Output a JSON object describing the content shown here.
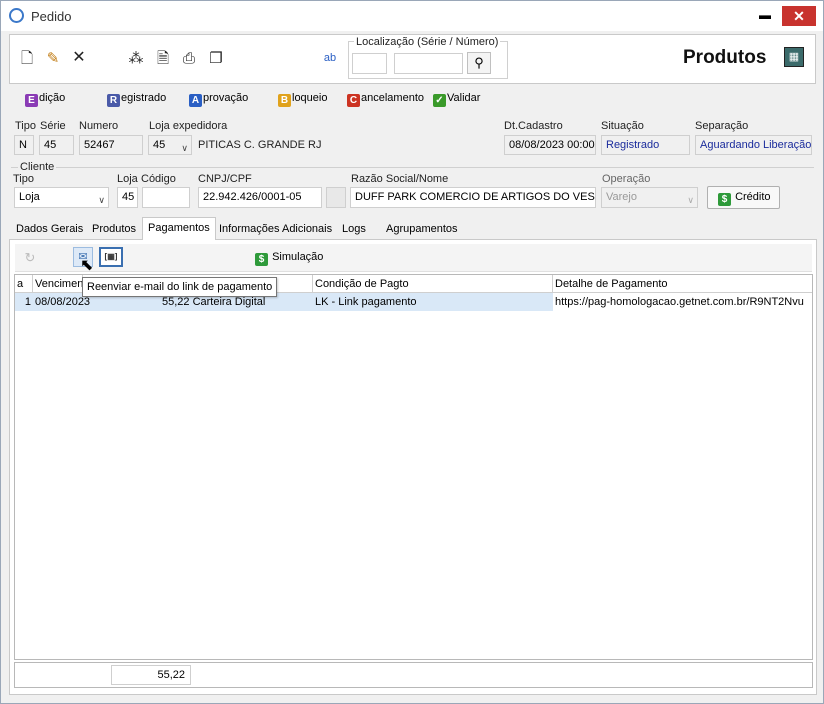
{
  "window": {
    "title": "Pedido",
    "minimize_glyph": "▬",
    "close_glyph": "✕"
  },
  "toolbar": {
    "icons": [
      "new-document-icon",
      "edit-document-icon",
      "delete-icon",
      "wand-icon",
      "preview-icon",
      "print-icon",
      "copy-icon",
      "spell-icon"
    ],
    "localizacao_label": "Localização (Série / Número)",
    "serie_value": "",
    "numero_value": "",
    "section_title": "Produtos"
  },
  "actions": [
    {
      "letter": "E",
      "color": "#8a3bb5",
      "rest": "dição"
    },
    {
      "letter": "R",
      "color": "#4a5aa8",
      "rest": "egistrado"
    },
    {
      "letter": "A",
      "color": "#2a5fc4",
      "rest": "provação"
    },
    {
      "letter": "B",
      "color": "#e0a21c",
      "rest": "loqueio"
    },
    {
      "letter": "C",
      "color": "#cc3322",
      "rest": "ancelamento"
    },
    {
      "letter": "",
      "color": "#3a9a2a",
      "rest": "Validar"
    }
  ],
  "header": {
    "tipo_label": "Tipo",
    "serie_label": "Série",
    "numero_label": "Numero",
    "loja_exp_label": "Loja expedidora",
    "dtcadastro_label": "Dt.Cadastro",
    "situacao_label": "Situação",
    "separacao_label": "Separação",
    "tipo_value": "N",
    "serie_value": "45",
    "numero_value": "52467",
    "loja_value": "45",
    "loja_name": "PITICAS C. GRANDE RJ",
    "dtcadastro_value": "08/08/2023 00:00",
    "situacao_value": "Registrado",
    "separacao_value": "Aguardando Liberação"
  },
  "cliente": {
    "group_label": "Cliente",
    "tipo_label": "Tipo",
    "loja_label": "Loja",
    "codigo_label": "Código",
    "cnpj_label": "CNPJ/CPF",
    "razao_label": "Razão Social/Nome",
    "operacao_label": "Operação",
    "tipo_value": "Loja",
    "loja_value": "45",
    "codigo_value": "",
    "cnpj_value": "22.942.426/0001-05",
    "razao_value": "DUFF PARK COMERCIO DE ARTIGOS DO VEST",
    "operacao_value": "Varejo",
    "credito_label": "Crédito",
    "credito_glyph": "$"
  },
  "tabs": [
    "Dados Gerais",
    "Produtos",
    "Pagamentos",
    "Informações Adicionais",
    "Logs",
    "Agrupamentos"
  ],
  "pagamentos": {
    "simulacao_label": "Simulação",
    "simulacao_glyph": "$",
    "tooltip": "Reenviar e-mail do link de pagamento",
    "columns": [
      "a",
      "Vencimen",
      "Condição de Pagto",
      "Detalhe de Pagamento"
    ],
    "rows": [
      {
        "idx": "1",
        "venc": "08/08/2023",
        "valor": "55,22 Carteira Digital",
        "condicao": "LK - Link pagamento",
        "detalhe": "https://pag-homologacao.getnet.com.br/R9NT2Nvu"
      }
    ],
    "total": "55,22"
  }
}
